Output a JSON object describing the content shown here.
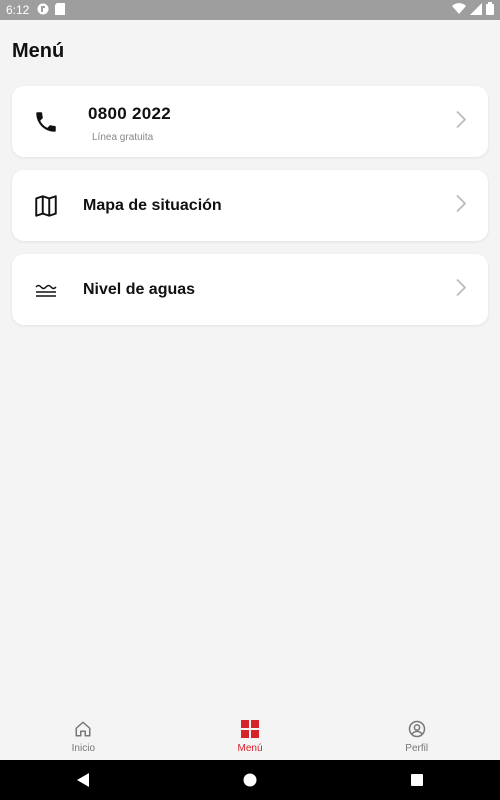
{
  "status_bar": {
    "time": "6:12"
  },
  "page_title": "Menú",
  "cards": {
    "phone": {
      "number": "0800 2022",
      "subtitle": "Línea gratuita"
    },
    "map": {
      "label": "Mapa de situación"
    },
    "water": {
      "label": "Nivel de aguas"
    }
  },
  "bottom_nav": {
    "items": [
      {
        "label": "Inicio",
        "icon": "home-icon",
        "active": false
      },
      {
        "label": "Menú",
        "icon": "grid-icon",
        "active": true
      },
      {
        "label": "Perfil",
        "icon": "profile-icon",
        "active": false
      }
    ],
    "active_color": "#d6222a"
  }
}
